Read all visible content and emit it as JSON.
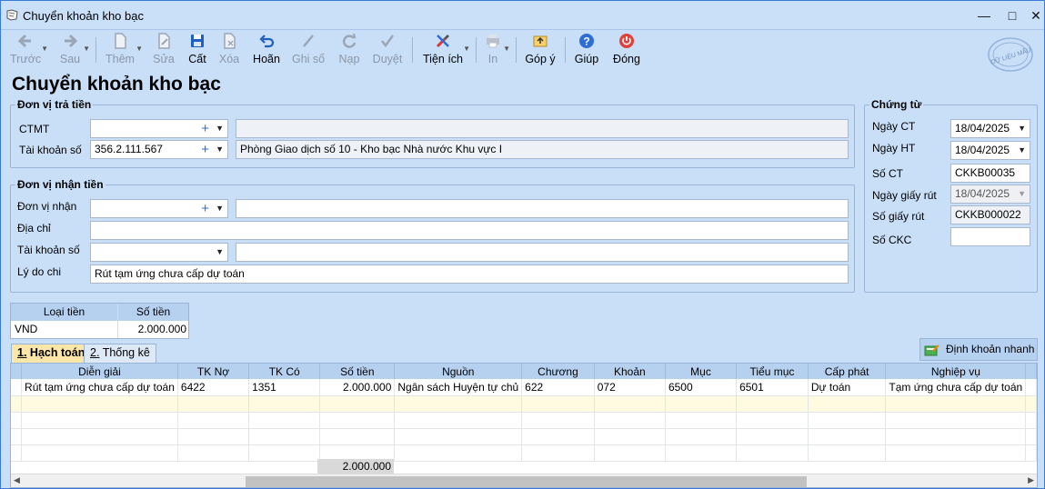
{
  "window": {
    "title": "Chuyển khoản kho bạc"
  },
  "toolbar": {
    "prev": "Trước",
    "next": "Sau",
    "add": "Thêm",
    "edit": "Sửa",
    "save": "Cất",
    "delete": "Xóa",
    "undo": "Hoãn",
    "post": "Ghi sổ",
    "load": "Nạp",
    "approve": "Duyệt",
    "utility": "Tiện ích",
    "print": "In",
    "feedback": "Góp ý",
    "help": "Giúp",
    "close": "Đóng"
  },
  "stamp_text": "DỮ LIỆU MẪU",
  "page_title": "Chuyển khoản kho bạc",
  "payer": {
    "title": "Đơn vị trả tiền",
    "ctmt_label": "CTMT",
    "ctmt_value": "",
    "ctmt_desc": "",
    "account_label": "Tài khoản số",
    "account_value": "356.2.111.567",
    "account_desc": "Phòng Giao dịch số 10 - Kho bạc Nhà nước Khu vực I"
  },
  "payee": {
    "title": "Đơn vị nhận tiền",
    "unit_label": "Đơn vị nhận",
    "unit_value": "",
    "unit_desc": "",
    "address_label": "Địa chỉ",
    "address_value": "",
    "account_label": "Tài khoản số",
    "account_value": "",
    "account_desc": "",
    "reason_label": "Lý do chi",
    "reason_value": "Rút tạm ứng chưa cấp dự toán"
  },
  "voucher": {
    "title": "Chứng từ",
    "ngay_ct_label": "Ngày CT",
    "ngay_ct": "18/04/2025",
    "ngay_ht_label": "Ngày HT",
    "ngay_ht": "18/04/2025",
    "so_ct_label": "Số CT",
    "so_ct": "CKKB00035",
    "ngay_giay_rut_label": "Ngày giấy rút",
    "ngay_giay_rut": "18/04/2025",
    "so_giay_rut_label": "Số giấy rút",
    "so_giay_rut": "CKKB000022",
    "so_ckc_label": "Số CKC",
    "so_ckc": ""
  },
  "currency": {
    "headers": [
      "Loại tiền",
      "Số tiền"
    ],
    "rows": [
      [
        "VND",
        "2.000.000"
      ]
    ]
  },
  "tabs": {
    "accounting_num": "1.",
    "accounting": "Hạch toán",
    "stats_num": "2.",
    "stats": "Thống kê"
  },
  "quick_entry": "Định khoản nhanh",
  "grid": {
    "headers": [
      "Diễn giải",
      "TK Nợ",
      "TK Có",
      "Số tiền",
      "Nguồn",
      "Chương",
      "Khoản",
      "Mục",
      "Tiểu mục",
      "Cấp phát",
      "Nghiệp vụ"
    ],
    "rows": [
      [
        "Rút tạm ứng chưa cấp dự toán",
        "6422",
        "1351",
        "2.000.000",
        "Ngân sách Huyện tự chủ",
        "622",
        "072",
        "6500",
        "6501",
        "Dự toán",
        "Tạm ứng chưa cấp dự toán"
      ]
    ],
    "total_amount": "2.000.000"
  }
}
